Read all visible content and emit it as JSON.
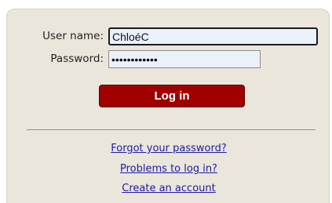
{
  "login_form": {
    "username_label": "User name:",
    "username_value": "ChloéC",
    "password_label": "Password:",
    "password_value": "••••••••••••",
    "login_button_label": "Log in",
    "button_color": "#a00000"
  },
  "links": {
    "forgot_password": "Forgot your password?",
    "problems": "Problems to log in?",
    "create_account": "Create an account"
  },
  "colors": {
    "panel_background": "#ebe6dc",
    "input_background": "#ebf1fb",
    "link_color": "#1a1aa6"
  }
}
